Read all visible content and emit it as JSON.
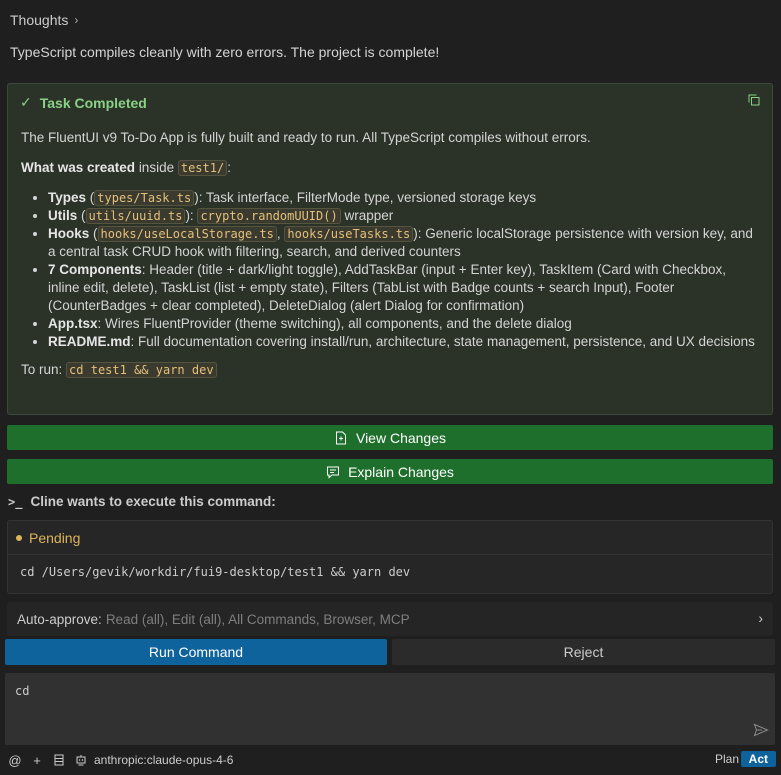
{
  "thoughts": {
    "label": "Thoughts",
    "chevron": "›"
  },
  "summary": "TypeScript compiles cleanly with zero errors. The project is complete!",
  "task": {
    "title": "Task Completed",
    "intro": "The FluentUI v9 To-Do App is fully built and ready to run. All TypeScript compiles without errors.",
    "created_label": "What was created",
    "created_inside": "inside",
    "created_dir": "test1/",
    "created_colon": ":",
    "items": [
      {
        "bold": "Types",
        "code": "types/Task.ts",
        "text": ": Task interface, FilterMode type, versioned storage keys"
      },
      {
        "bold": "Utils",
        "code": "utils/uuid.ts",
        "code2": "crypto.randomUUID()",
        "text": " wrapper"
      },
      {
        "bold": "Hooks",
        "code": "hooks/useLocalStorage.ts",
        "code2": "hooks/useTasks.ts",
        "text": ": Generic localStorage persistence with version key, and a central task CRUD hook with filtering, search, and derived counters"
      },
      {
        "bold": "7 Components",
        "text": ": Header (title + dark/light toggle), AddTaskBar (input + Enter key), TaskItem (Card with Checkbox, inline edit, delete), TaskList (list + empty state), Filters (TabList with Badge counts + search Input), Footer (CounterBadges + clear completed), DeleteDialog (alert Dialog for confirmation)"
      },
      {
        "bold": "App.tsx",
        "text": ": Wires FluentProvider (theme switching), all components, and the delete dialog"
      },
      {
        "bold": "README.md",
        "text": ": Full documentation covering install/run, architecture, state management, persistence, and UX decisions"
      }
    ],
    "run_label": "To run:",
    "run_code": "cd test1 && yarn dev"
  },
  "buttons": {
    "view_changes": "View Changes",
    "explain_changes": "Explain Changes",
    "run_command": "Run Command",
    "reject": "Reject"
  },
  "command": {
    "title": "Cline wants to execute this command:",
    "status": "Pending",
    "text": "cd /Users/gevik/workdir/fui9-desktop/test1 && yarn dev"
  },
  "auto_approve": {
    "label": "Auto-approve:",
    "value": "Read (all), Edit (all), All Commands, Browser, MCP"
  },
  "input": {
    "value": "cd"
  },
  "bottom": {
    "model": "anthropic:claude-opus-4-6",
    "plan": "Plan",
    "act": "Act"
  },
  "colors": {
    "accent": "#0e639c",
    "success": "#89d185",
    "green_button": "#1f6f2c",
    "pending": "#dcb45a"
  }
}
